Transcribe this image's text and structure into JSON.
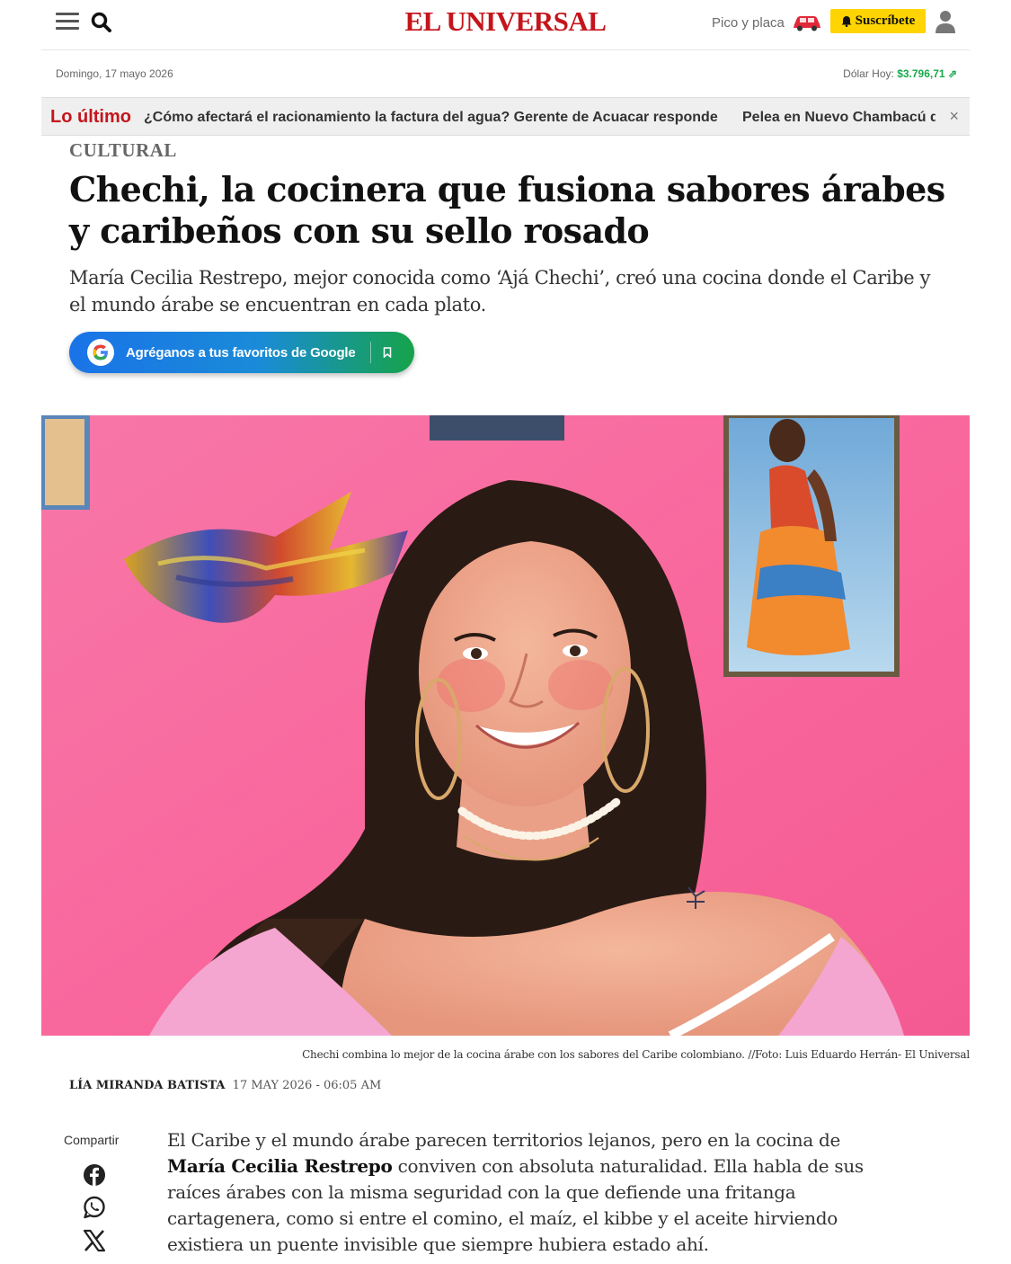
{
  "header": {
    "logo": "EL UNIVERSAL",
    "pico_y_placa": "Pico y placa",
    "subscribe_label": "Suscríbete",
    "date": "Domingo, 17 mayo 2026",
    "dolar_label": "Dólar Hoy:",
    "dolar_value": "$3.796,71"
  },
  "ticker": {
    "label": "Lo último",
    "items": [
      "¿Cómo afectará el racionamiento la factura del agua? Gerente de Acuacar responde",
      "Pelea en Nuevo Chambacú d"
    ],
    "close": "×"
  },
  "article": {
    "section": "CULTURAL",
    "title": "Chechi, la cocinera que fusiona sabores árabes y caribeños con su sello rosado",
    "lead": "María Cecilia Restrepo, mejor conocida como ‘Ajá Chechi’, creó una cocina donde el Caribe y el mundo árabe se encuentran en cada plato.",
    "google_button": "Agréganos a tus favoritos de Google",
    "caption": "Chechi combina lo mejor de la cocina árabe con los sabores del Caribe colombiano. //Foto: Luis Eduardo Herrán- El Universal",
    "author": "LÍA MIRANDA BATISTA",
    "published": "17 MAY 2026 - 06:05 AM",
    "share_label": "Compartir",
    "body_before": "El Caribe y el mundo árabe parecen territorios lejanos, pero en la cocina de ",
    "body_bold": "María Cecilia Restrepo",
    "body_after": " conviven con absoluta naturalidad. Ella habla de sus raíces árabes con la misma seguridad con la que defiende una fritanga cartagenera, como si entre el comino, el maíz, el kibbe y el aceite hirviendo existiera un puente invisible que siempre hubiera estado ahí."
  },
  "colors": {
    "brand_red": "#c4151c",
    "subscribe_yellow": "#ffd400",
    "dolar_green": "#1aa84c",
    "photo_pink": "#f86aa0"
  }
}
